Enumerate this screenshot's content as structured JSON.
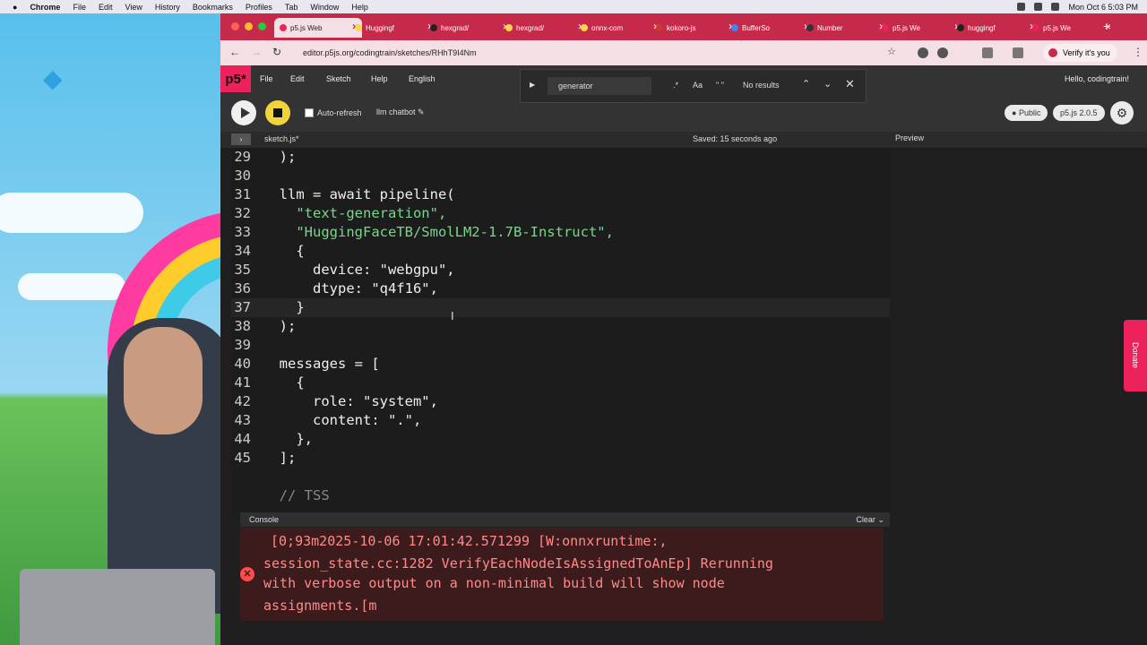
{
  "menubar": {
    "app": "Chrome",
    "items": [
      "File",
      "Edit",
      "View",
      "History",
      "Bookmarks",
      "Profiles",
      "Tab",
      "Window",
      "Help"
    ],
    "clock": "Mon Oct 6  5:03 PM"
  },
  "tabs": [
    {
      "label": "p5.js Web",
      "active": true
    },
    {
      "label": "Huggingf"
    },
    {
      "label": "hexgrad/"
    },
    {
      "label": "hexgrad/"
    },
    {
      "label": "onnx-com"
    },
    {
      "label": "kokoro-js"
    },
    {
      "label": "BufferSo"
    },
    {
      "label": "Number"
    },
    {
      "label": "p5.js We"
    },
    {
      "label": "huggingf"
    },
    {
      "label": "p5.js We"
    }
  ],
  "address": "editor.p5js.org/codingtrain/sketches/RHhT9I4Nm",
  "profile_label": "Verify it's you",
  "p5": {
    "logo": "p5*",
    "menu": [
      "File",
      "Edit",
      "Sketch",
      "Help",
      "English"
    ],
    "greeting": "Hello, codingtrain!",
    "find": {
      "query": "generator",
      "regex": ".*",
      "case": "Aa",
      "word": "\" \"",
      "result": "No results"
    },
    "auto_refresh": "Auto-refresh",
    "sketch_name": "llm chatbot",
    "visibility": "Public",
    "version": "p5.js 2.0.5",
    "file": "sketch.js*",
    "saved": "Saved: 15 seconds ago",
    "preview": "Preview",
    "donate": "Donate"
  },
  "code_lines": [
    {
      "n": "29",
      "t": "  );"
    },
    {
      "n": "30",
      "t": ""
    },
    {
      "n": "31",
      "t": "  llm = await pipeline("
    },
    {
      "n": "32",
      "t": "    \"text-generation\","
    },
    {
      "n": "33",
      "t": "    \"HuggingFaceTB/SmolLM2-1.7B-Instruct\","
    },
    {
      "n": "34",
      "t": "    {"
    },
    {
      "n": "35",
      "t": "      device: \"webgpu\","
    },
    {
      "n": "36",
      "t": "      dtype: \"q4f16\","
    },
    {
      "n": "37",
      "t": "    }"
    },
    {
      "n": "38",
      "t": "  );"
    },
    {
      "n": "39",
      "t": ""
    },
    {
      "n": "40",
      "t": "  messages = ["
    },
    {
      "n": "41",
      "t": "    {"
    },
    {
      "n": "42",
      "t": "      role: \"system\","
    },
    {
      "n": "43",
      "t": "      content: \".\","
    },
    {
      "n": "44",
      "t": "    },"
    },
    {
      "n": "45",
      "t": "  ];"
    },
    {
      "n": "",
      "t": ""
    },
    {
      "n": "",
      "t": "  // TSS"
    }
  ],
  "console": {
    "label": "Console",
    "clear": "Clear",
    "lines": [
      "[0;93m2025-10-06 17:01:42.571299 [W:onnxruntime:,",
      "session_state.cc:1282 VerifyEachNodeIsAssignedToAnEp] Rerunning",
      "with verbose output on a non-minimal build will show node",
      "assignments.[m"
    ]
  }
}
